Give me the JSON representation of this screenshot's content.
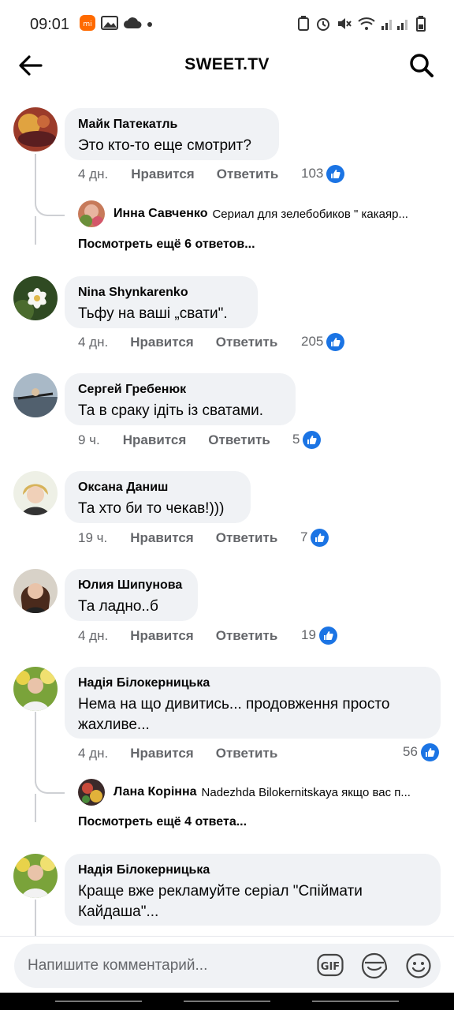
{
  "status_bar": {
    "time": "09:01"
  },
  "header": {
    "title": "SWEET.TV"
  },
  "comments": [
    {
      "author": "Майк Патекатль",
      "text": "Это кто-то еще смотрит?",
      "time": "4 дн.",
      "like": "Нравится",
      "reply": "Ответить",
      "reactions": "103",
      "replies": {
        "author": "Инна Савченко",
        "text": "Сериал для зелебобиков \" какаяр...",
        "more": "Посмотреть ещё 6 ответов..."
      }
    },
    {
      "author": "Nina Shynkarenko",
      "text": "Тьфу на ваші  „свати\".",
      "time": "4 дн.",
      "like": "Нравится",
      "reply": "Ответить",
      "reactions": "205"
    },
    {
      "author": "Сергей Гребенюк",
      "text": "Та в сраку ідіть із сватами.",
      "time": "9 ч.",
      "like": "Нравится",
      "reply": "Ответить",
      "reactions": "5"
    },
    {
      "author": "Оксана Даниш",
      "text": "Та хто би то чекав!)))",
      "time": "19 ч.",
      "like": "Нравится",
      "reply": "Ответить",
      "reactions": "7"
    },
    {
      "author": "Юлия Шипунова",
      "text": "Та ладно..б",
      "time": "4 дн.",
      "like": "Нравится",
      "reply": "Ответить",
      "reactions": "19"
    },
    {
      "author": "Надія Білокерницька",
      "text_line1": "Нема на що дивитись... продовження просто",
      "text_line2": "жахливе...",
      "time": "4 дн.",
      "like": "Нравится",
      "reply": "Ответить",
      "reactions": "56",
      "replies": {
        "author": "Лана Корінна",
        "text": "Nadezhda Bilokernitskaya якщо вас п...",
        "more": "Посмотреть ещё 4 ответа..."
      }
    },
    {
      "author": "Надія Білокерницька",
      "text_line1": "Краще  вже рекламуйте серіал \"Спіймати",
      "text_line2": "Кайдаша\"..."
    }
  ],
  "composer": {
    "placeholder": "Напишите комментарий...",
    "gif_label": "GIF"
  },
  "colors": {
    "accent": "#1b74e4",
    "bubble": "#f0f2f5",
    "secondary_text": "#65676b"
  }
}
